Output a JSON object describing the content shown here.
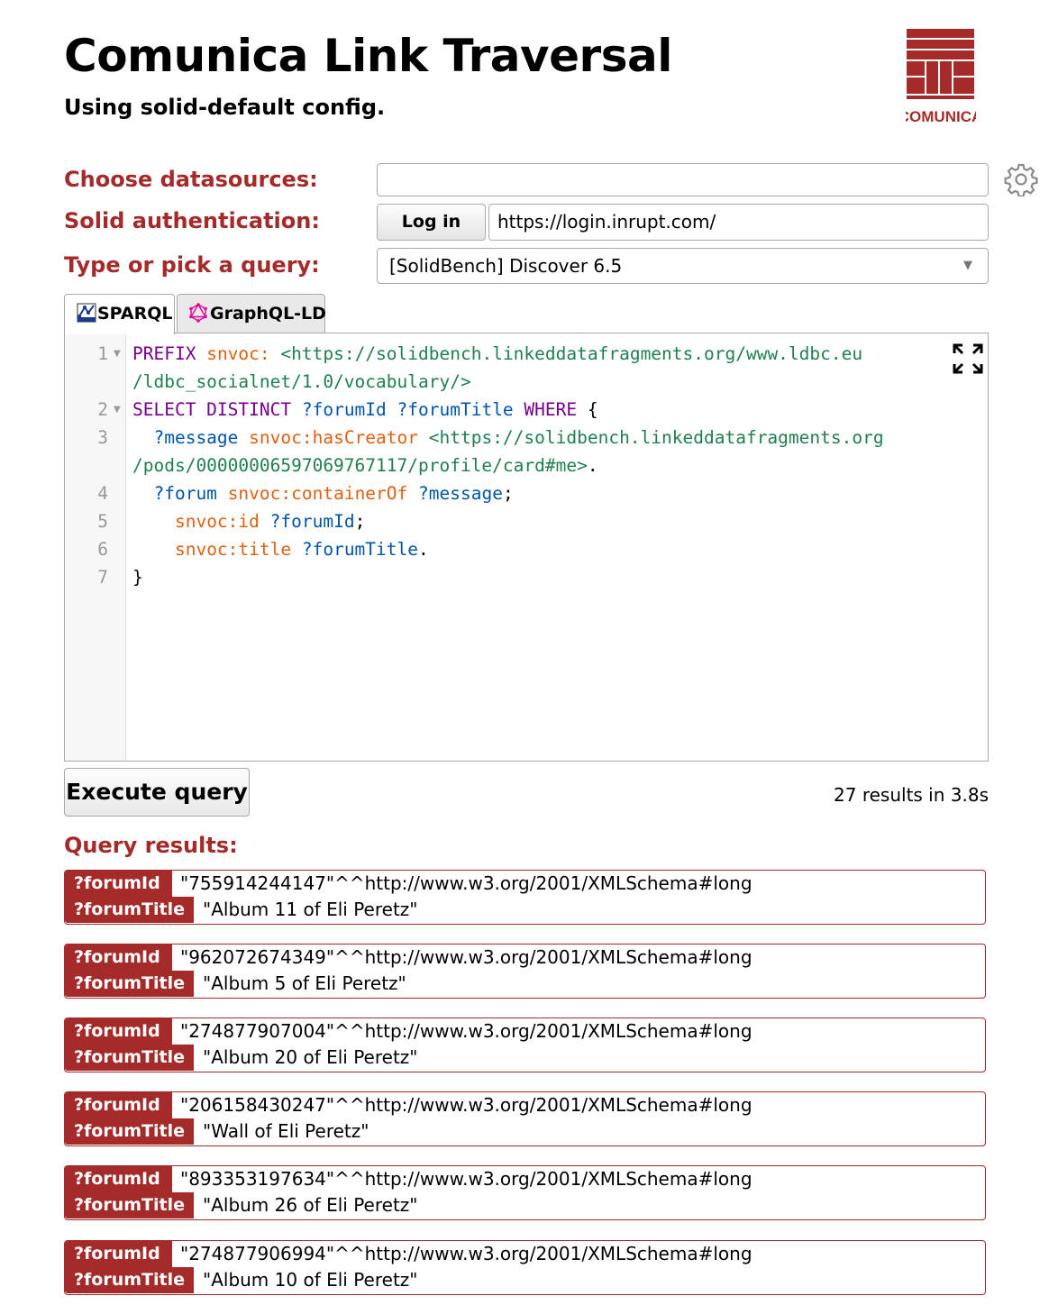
{
  "header": {
    "title": "Comunica Link Traversal",
    "subtitle": "Using solid-default config.",
    "logo_text": "COMUNICA"
  },
  "form": {
    "datasources_label": "Choose datasources:",
    "datasources_value": "",
    "auth_label": "Solid authentication:",
    "login_button": "Log in",
    "idp_value": "https://login.inrupt.com/",
    "query_label": "Type or pick a query:",
    "query_selected": "[SolidBench] Discover 6.5"
  },
  "tabs": [
    {
      "label": "SPARQL",
      "icon": "sparql-icon",
      "active": true
    },
    {
      "label": "GraphQL-LD",
      "icon": "graphql-icon",
      "active": false
    }
  ],
  "editor": {
    "lines": [
      {
        "num": "1",
        "fold": true,
        "segments": [
          [
            "kw",
            "PREFIX"
          ],
          [
            "pn",
            " "
          ],
          [
            "at",
            "snvoc:"
          ],
          [
            "pn",
            " "
          ],
          [
            "url",
            "<https://solidbench.linkeddatafragments.org/www.ldbc.eu"
          ]
        ]
      },
      {
        "num": "",
        "fold": false,
        "segments": [
          [
            "url",
            "/ldbc_socialnet/1.0/vocabulary/>"
          ]
        ]
      },
      {
        "num": "2",
        "fold": true,
        "segments": [
          [
            "kw",
            "SELECT DISTINCT"
          ],
          [
            "pn",
            " "
          ],
          [
            "var",
            "?forumId"
          ],
          [
            "pn",
            " "
          ],
          [
            "var",
            "?forumTitle"
          ],
          [
            "pn",
            " "
          ],
          [
            "kw",
            "WHERE"
          ],
          [
            "pn",
            " {"
          ]
        ]
      },
      {
        "num": "3",
        "fold": false,
        "segments": [
          [
            "pn",
            "  "
          ],
          [
            "var",
            "?message"
          ],
          [
            "pn",
            " "
          ],
          [
            "at",
            "snvoc:hasCreator"
          ],
          [
            "pn",
            " "
          ],
          [
            "url",
            "<https://solidbench.linkeddatafragments.org"
          ]
        ]
      },
      {
        "num": "",
        "fold": false,
        "segments": [
          [
            "url",
            "/pods/00000006597069767117/profile/card#me>"
          ],
          [
            "pn",
            "."
          ]
        ]
      },
      {
        "num": "4",
        "fold": false,
        "segments": [
          [
            "pn",
            "  "
          ],
          [
            "var",
            "?forum"
          ],
          [
            "pn",
            " "
          ],
          [
            "at",
            "snvoc:containerOf"
          ],
          [
            "pn",
            " "
          ],
          [
            "var",
            "?message"
          ],
          [
            "pn",
            ";"
          ]
        ]
      },
      {
        "num": "5",
        "fold": false,
        "segments": [
          [
            "pn",
            "    "
          ],
          [
            "at",
            "snvoc:id"
          ],
          [
            "pn",
            " "
          ],
          [
            "var",
            "?forumId"
          ],
          [
            "pn",
            ";"
          ]
        ]
      },
      {
        "num": "6",
        "fold": false,
        "segments": [
          [
            "pn",
            "    "
          ],
          [
            "at",
            "snvoc:title"
          ],
          [
            "pn",
            " "
          ],
          [
            "var",
            "?forumTitle"
          ],
          [
            "pn",
            "."
          ]
        ]
      },
      {
        "num": "7",
        "fold": false,
        "segments": [
          [
            "pn",
            "}"
          ]
        ]
      }
    ]
  },
  "execute_button": "Execute query",
  "status": "27 results in 3.8s",
  "results_title": "Query results:",
  "results": [
    {
      "k1": "?forumId",
      "v1": "\"755914244147\"^^http://www.w3.org/2001/XMLSchema#long",
      "k2": "?forumTitle",
      "v2": "\"Album 11 of Eli Peretz\""
    },
    {
      "k1": "?forumId",
      "v1": "\"962072674349\"^^http://www.w3.org/2001/XMLSchema#long",
      "k2": "?forumTitle",
      "v2": "\"Album 5 of Eli Peretz\""
    },
    {
      "k1": "?forumId",
      "v1": "\"274877907004\"^^http://www.w3.org/2001/XMLSchema#long",
      "k2": "?forumTitle",
      "v2": "\"Album 20 of Eli Peretz\""
    },
    {
      "k1": "?forumId",
      "v1": "\"206158430247\"^^http://www.w3.org/2001/XMLSchema#long",
      "k2": "?forumTitle",
      "v2": "\"Wall of Eli Peretz\""
    },
    {
      "k1": "?forumId",
      "v1": "\"893353197634\"^^http://www.w3.org/2001/XMLSchema#long",
      "k2": "?forumTitle",
      "v2": "\"Album 26 of Eli Peretz\""
    },
    {
      "k1": "?forumId",
      "v1": "\"274877906994\"^^http://www.w3.org/2001/XMLSchema#long",
      "k2": "?forumTitle",
      "v2": "\"Album 10 of Eli Peretz\""
    }
  ],
  "colors": {
    "brand": "#a52a2a",
    "keyword": "#770088",
    "attribute": "#e06010",
    "url": "#1f7f4f",
    "variable": "#0055aa"
  }
}
